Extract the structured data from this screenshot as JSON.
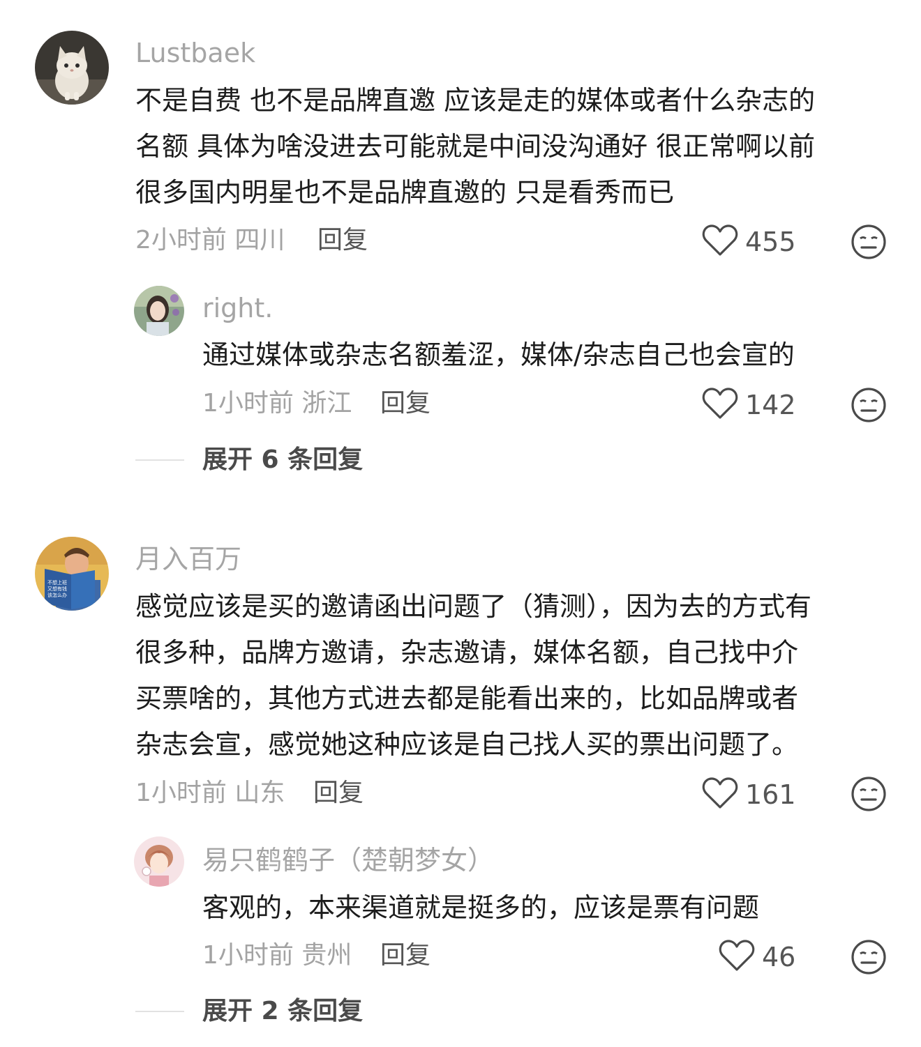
{
  "comments": [
    {
      "username": "Lustbaek",
      "lines": [
        "不是自费 也不是品牌直邀 应该是走的媒体或者什么杂志的",
        "名额 具体为啥没进去可能就是中间没沟通好 很正常啊以前",
        "很多国内明星也不是品牌直邀的 只是看秀而已"
      ],
      "time_location": "2小时前 四川",
      "reply_label": "回复",
      "likes": "455",
      "replies": [
        {
          "username": "right.",
          "lines": [
            "通过媒体或杂志名额羞涩，媒体/杂志自己也会宣的"
          ],
          "time_location": "1小时前 浙江",
          "reply_label": "回复",
          "likes": "142"
        }
      ],
      "expand_label": "展开 6 条回复"
    },
    {
      "username": "月入百万",
      "lines": [
        "感觉应该是买的邀请函出问题了（猜测），因为去的方式有",
        "很多种，品牌方邀请，杂志邀请，媒体名额，自己找中介",
        "买票啥的，其他方式进去都是能看出来的，比如品牌或者",
        "杂志会宣，感觉她这种应该是自己找人买的票出问题了。"
      ],
      "time_location": "1小时前 山东",
      "reply_label": "回复",
      "likes": "161",
      "avatar_book_text": "不想上班 又想有钱 该怎么办",
      "replies": [
        {
          "username": "易只鹤鹤子（楚朝梦女）",
          "lines": [
            "客观的，本来渠道就是挺多的，应该是票有问题"
          ],
          "time_location": "1小时前 贵州",
          "reply_label": "回复",
          "likes": "46"
        }
      ],
      "expand_label": "展开 2 条回复"
    }
  ],
  "icons": {
    "like": "heart-outline-icon",
    "dislike": "meh-face-icon"
  },
  "colors": {
    "username": "#a5a5a5",
    "meta": "#a3a3a3",
    "text": "#1c1c1c",
    "icon": "#4a4a4a"
  }
}
